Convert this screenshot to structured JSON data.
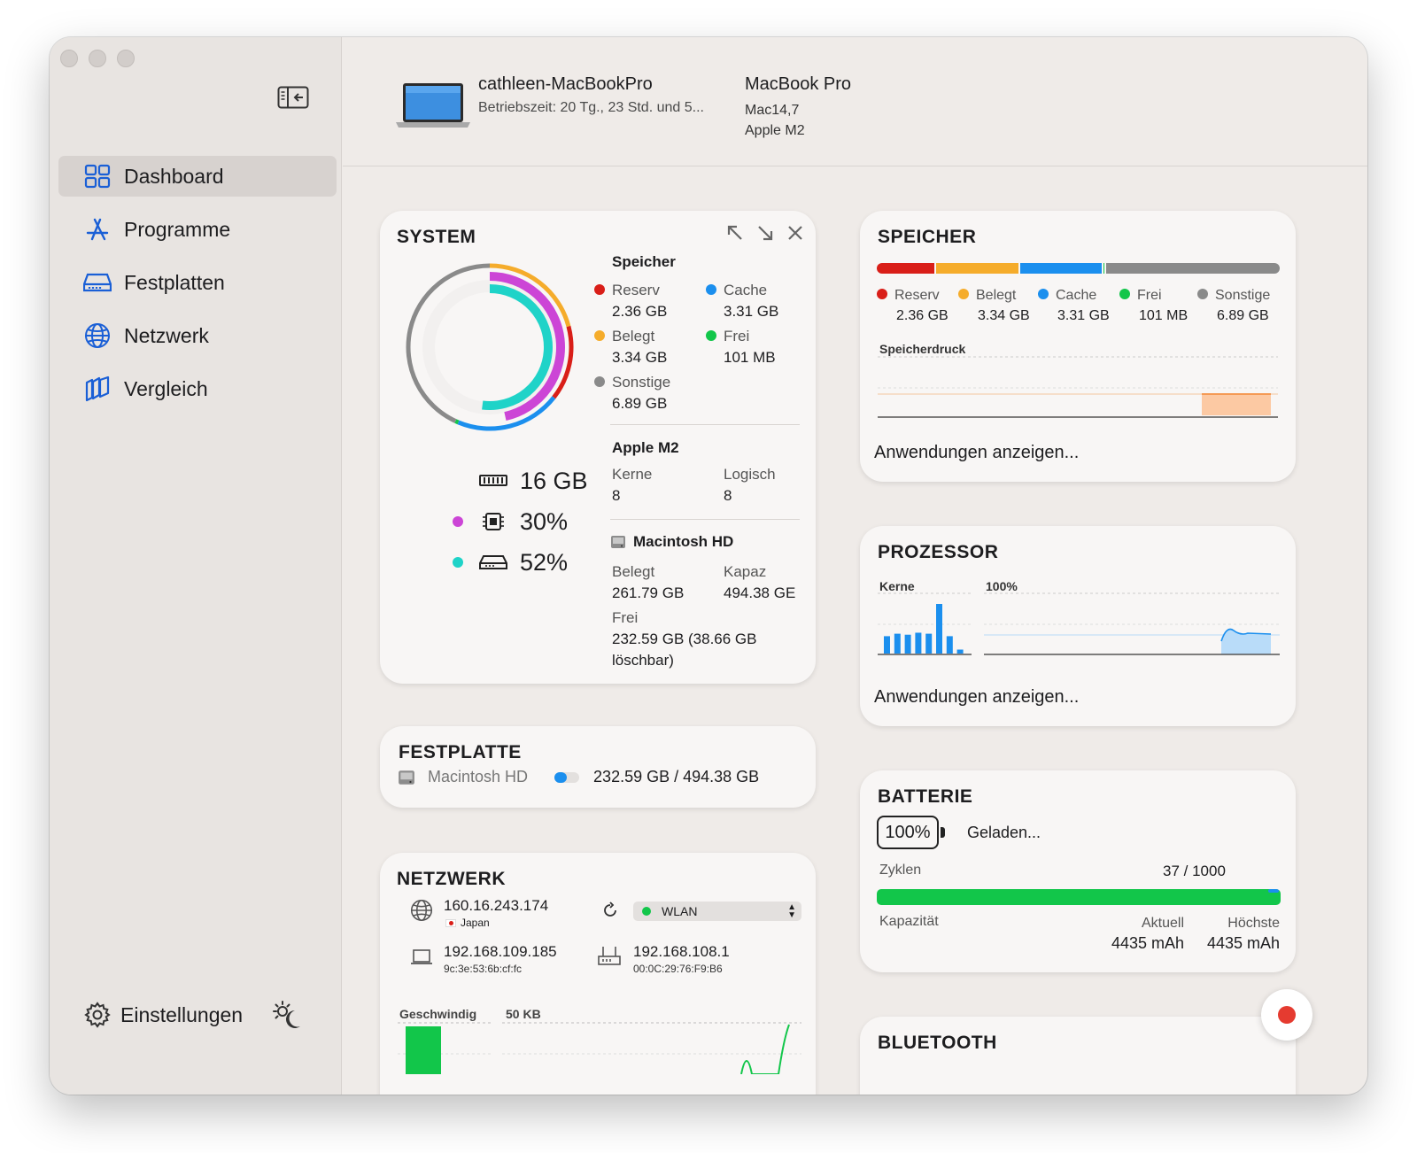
{
  "sidebar": {
    "items": [
      {
        "label": "Dashboard",
        "icon": "grid-icon",
        "active": true
      },
      {
        "label": "Programme",
        "icon": "app-store-icon",
        "active": false
      },
      {
        "label": "Festplatten",
        "icon": "drive-icon",
        "active": false
      },
      {
        "label": "Netzwerk",
        "icon": "globe-icon",
        "active": false
      },
      {
        "label": "Vergleich",
        "icon": "compare-icon",
        "active": false
      }
    ],
    "settings_label": "Einstellungen"
  },
  "header": {
    "hostname": "cathleen-MacBookPro",
    "uptime": "Betriebszeit: 20 Tg., 23 Std. und 5...",
    "model": "MacBook Pro",
    "model_id": "Mac14,7",
    "chip": "Apple M2"
  },
  "colors": {
    "accent": "#1a5fd6",
    "reserv": "#d91e18",
    "belegt": "#f5ac2b",
    "cache": "#1b8fee",
    "frei": "#12c64a",
    "sonstige": "#8a8a8a",
    "cpu": "#cc45d6",
    "disk": "#1fd3c8"
  },
  "system": {
    "title": "SYSTEM",
    "memory_total": "16 GB",
    "cpu_percent": "30%",
    "disk_percent": "52%",
    "memory_heading": "Speicher",
    "memory_legend": [
      {
        "label": "Reserv",
        "value": "2.36 GB",
        "color": "#d91e18"
      },
      {
        "label": "Cache",
        "value": "3.31 GB",
        "color": "#1b8fee"
      },
      {
        "label": "Belegt",
        "value": "3.34 GB",
        "color": "#f5ac2b"
      },
      {
        "label": "Frei",
        "value": "101 MB",
        "color": "#12c64a"
      },
      {
        "label": "Sonstige",
        "value": "6.89 GB",
        "color": "#8a8a8a"
      }
    ],
    "chip_heading": "Apple M2",
    "cores_label": "Kerne",
    "cores_value": "8",
    "logical_label": "Logisch",
    "logical_value": "8",
    "disk_heading": "Macintosh HD",
    "disk_used_label": "Belegt",
    "disk_used_value": "261.79 GB",
    "disk_cap_label": "Kapaz",
    "disk_cap_value": "494.38 GE",
    "disk_free_label": "Frei",
    "disk_free_value": "232.59 GB (38.66 GB löschbar)",
    "ring": {
      "memory_fraction": 0.63,
      "cpu_fraction": 0.3,
      "disk_fraction": 0.52
    }
  },
  "festplatte": {
    "title": "FESTPLATTE",
    "disk_name": "Macintosh HD",
    "usage": "232.59 GB / 494.38 GB"
  },
  "netzwerk": {
    "title": "NETZWERK",
    "public_ip": "160.16.243.174",
    "country": "Japan",
    "interface": "WLAN",
    "local_ip": "192.168.109.185",
    "mac": "9c:3e:53:6b:cf:fc",
    "router_ip": "192.168.108.1",
    "router_mac": "00:0C:29:76:F9:B6",
    "speed_label": "Geschwindig",
    "scale_label": "50 KB"
  },
  "speicher": {
    "title": "SPEICHER",
    "bar": [
      {
        "label": "Reserv",
        "value": "2.36 GB",
        "color": "#d91e18",
        "fraction": 0.147
      },
      {
        "label": "Belegt",
        "value": "3.34 GB",
        "color": "#f5ac2b",
        "fraction": 0.209
      },
      {
        "label": "Cache",
        "value": "3.31 GB",
        "color": "#1b8fee",
        "fraction": 0.207
      },
      {
        "label": "Frei",
        "value": "101 MB",
        "color": "#12c64a",
        "fraction": 0.006
      },
      {
        "label": "Sonstige",
        "value": "6.89 GB",
        "color": "#8a8a8a",
        "fraction": 0.431
      }
    ],
    "pressure_label": "Speicherdruck",
    "show_apps": "Anwendungen anzeigen..."
  },
  "prozessor": {
    "title": "PROZESSOR",
    "cores_label": "Kerne",
    "scale_label": "100%",
    "core_loads": [
      0.35,
      0.4,
      0.38,
      0.42,
      0.4,
      1.0,
      0.35,
      0.08
    ],
    "show_apps": "Anwendungen anzeigen..."
  },
  "batterie": {
    "title": "BATTERIE",
    "percent": "100%",
    "status": "Geladen...",
    "cycles_label": "Zyklen",
    "cycles_value": "37 / 1000",
    "capacity_label": "Kapazität",
    "current_label": "Aktuell",
    "current_value": "4435 mAh",
    "max_label": "Höchste",
    "max_value": "4435 mAh"
  },
  "bluetooth": {
    "title": "BLUETOOTH"
  }
}
